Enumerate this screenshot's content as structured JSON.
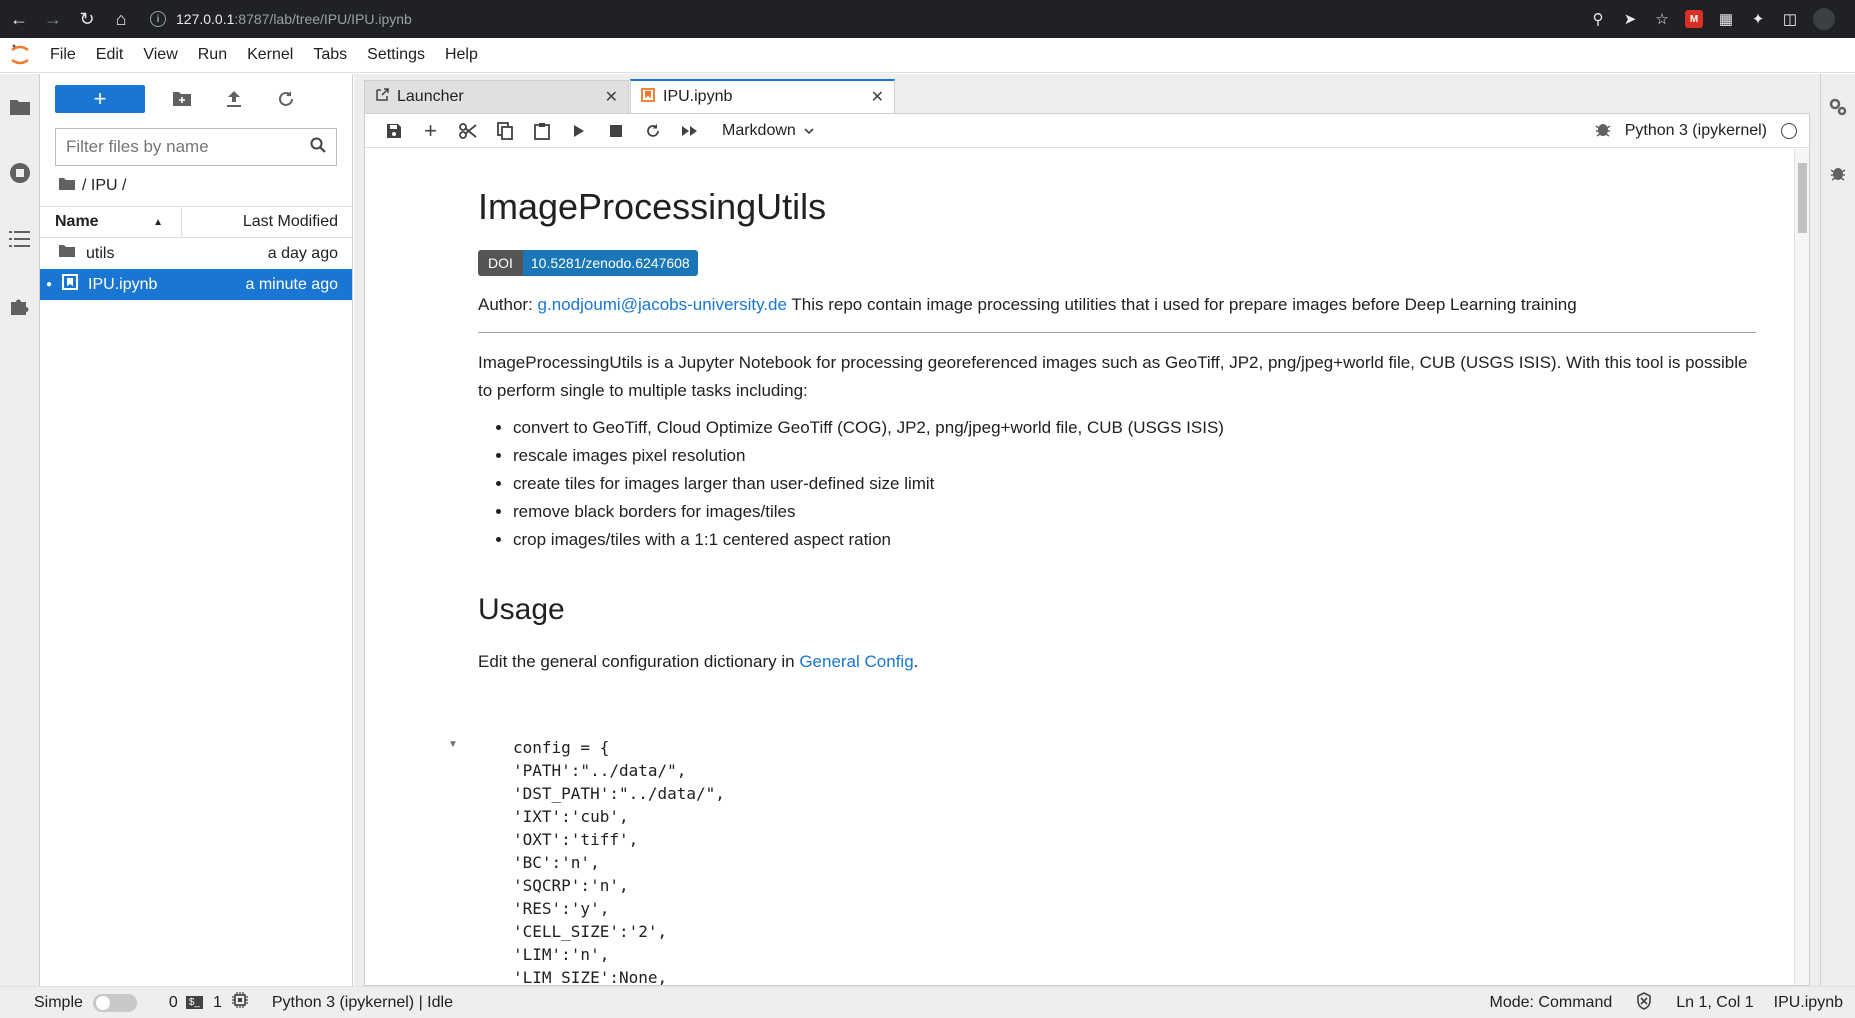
{
  "browser": {
    "url_host": "127.0.0.1",
    "url_path": ":8787/lab/tree/IPU/IPU.ipynb"
  },
  "menu": [
    "File",
    "Edit",
    "View",
    "Run",
    "Kernel",
    "Tabs",
    "Settings",
    "Help"
  ],
  "filebrowser": {
    "new_label": "+",
    "filter_placeholder": "Filter files by name",
    "breadcrumb": "/ IPU /",
    "col_name": "Name",
    "col_modified": "Last Modified",
    "files": [
      {
        "name": "utils",
        "modified": "a day ago",
        "type": "folder",
        "selected": false
      },
      {
        "name": "IPU.ipynb",
        "modified": "a minute ago",
        "type": "notebook",
        "selected": true
      }
    ]
  },
  "tabs": [
    {
      "label": "Launcher",
      "active": false
    },
    {
      "label": "IPU.ipynb",
      "active": true
    }
  ],
  "notebook_toolbar": {
    "cell_type": "Markdown",
    "kernel": "Python 3 (ipykernel)"
  },
  "content": {
    "title": "ImageProcessingUtils",
    "doi_label": "DOI",
    "doi_value": "10.5281/zenodo.6247608",
    "author_prefix": "Author: ",
    "author_email": "g.nodjoumi@jacobs-university.de",
    "author_suffix": " This repo contain image processing utilities that i used for prepare images before Deep Learning training",
    "intro": "ImageProcessingUtils is a Jupyter Notebook for processing georeferenced images such as GeoTiff, JP2, png/jpeg+world file, CUB (USGS ISIS). With this tool is possible to perform single to multiple tasks including:",
    "tasks": [
      "convert to GeoTiff, Cloud Optimize GeoTiff (COG), JP2, png/jpeg+world file, CUB (USGS ISIS)",
      "rescale images pixel resolution",
      "create tiles for images larger than user-defined size limit",
      "remove black borders for images/tiles",
      "crop images/tiles with a 1:1 centered aspect ration"
    ],
    "usage_heading": "Usage",
    "usage_text": "Edit the general configuration dictionary in ",
    "usage_link": "General Config",
    "usage_end": ".",
    "code_lines": [
      "config = {",
      "'PATH':\"../data/\",",
      "'DST_PATH':\"../data/\",",
      "'IXT':'cub',",
      "'OXT':'tiff',",
      "'BC':'n',",
      "'SQCRP':'n',",
      "'RES':'y',",
      "'CELL_SIZE':'2',",
      "'LIM':'n',",
      "'LIM_SIZE':None,"
    ]
  },
  "status": {
    "mode_toggle": "Simple",
    "terminals": "0",
    "kernels": "1",
    "kernel_status": "Python 3 (ipykernel) | Idle",
    "mode": "Mode: Command",
    "cursor": "Ln 1, Col 1",
    "filename": "IPU.ipynb"
  },
  "colors": {
    "accent": "#1976d2",
    "selection": "#1976d2",
    "doi_left": "#555555",
    "doi_right": "#1976b7"
  }
}
